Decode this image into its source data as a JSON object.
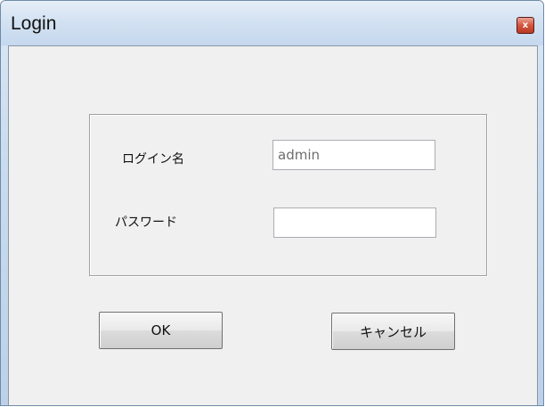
{
  "window": {
    "title": "Login",
    "close_glyph": "x",
    "close_icon": "close-icon"
  },
  "form": {
    "username_label": "ログイン名",
    "username_value": "admin",
    "password_label": "パスワード",
    "password_value": ""
  },
  "buttons": {
    "ok_label": "OK",
    "cancel_label": "キャンセル"
  },
  "colors": {
    "close_button": "#d4543e",
    "title_bar": "#c9dbee",
    "client_background": "#f0f0f0"
  }
}
